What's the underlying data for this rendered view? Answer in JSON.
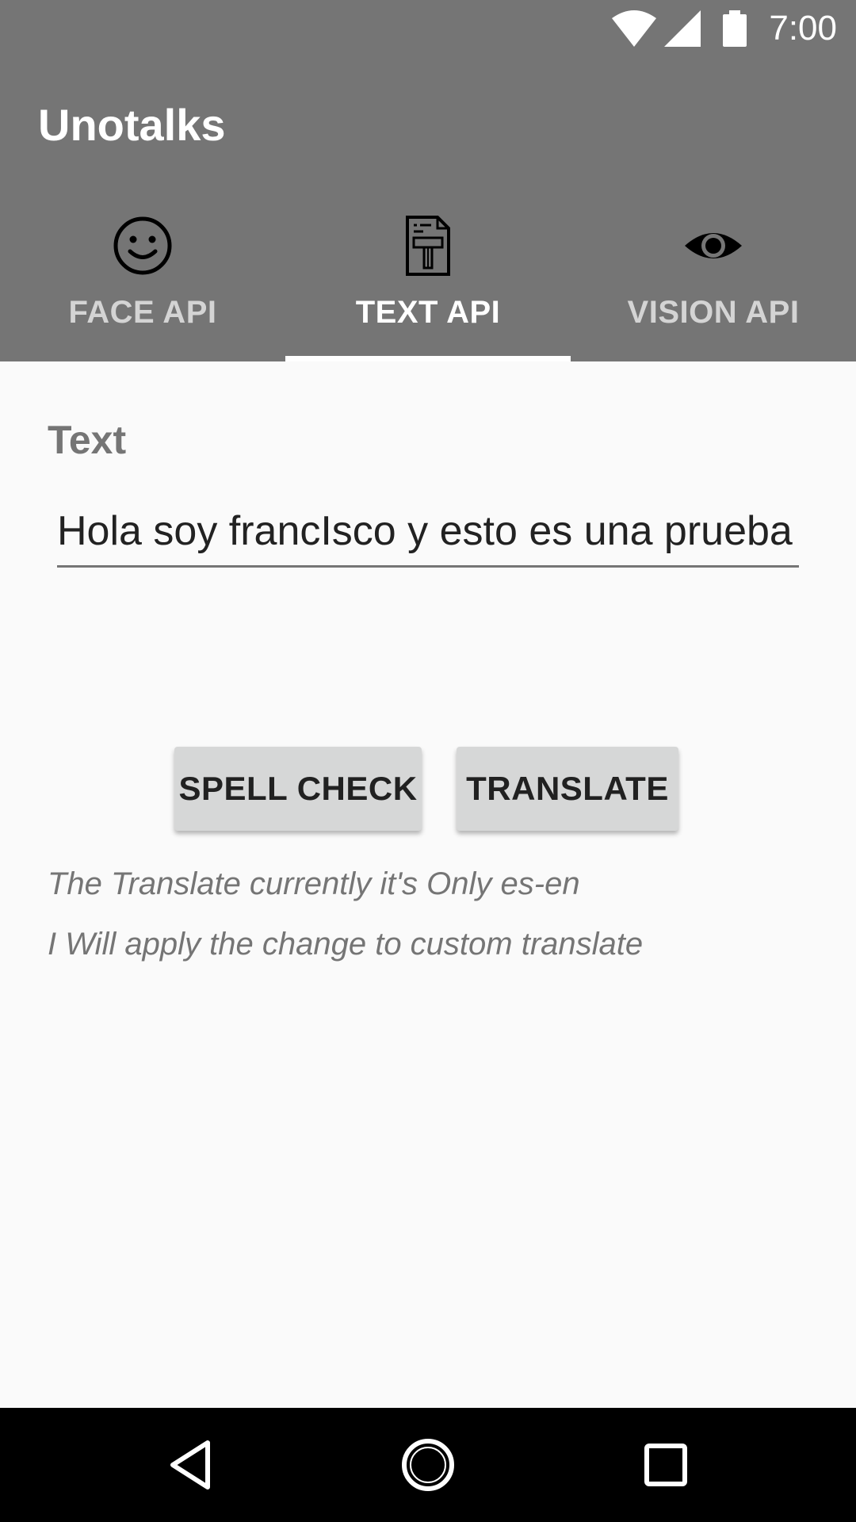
{
  "status_bar": {
    "time": "7:00"
  },
  "app": {
    "title": "Unotalks"
  },
  "tabs": [
    {
      "label": "FACE API",
      "icon": "smiley-face-icon"
    },
    {
      "label": "TEXT API",
      "icon": "text-document-icon"
    },
    {
      "label": "VISION API",
      "icon": "eye-icon"
    }
  ],
  "active_tab": "TEXT API",
  "form": {
    "label": "Text",
    "input_value": "Hola soy francIsco y esto es una prueba"
  },
  "buttons": {
    "spell_check": "SPELL CHECK",
    "translate": "TRANSLATE"
  },
  "notes": [
    "The Translate currently it's Only es-en",
    "I Will apply the change to custom translate"
  ],
  "colors": {
    "appbar": "#757575",
    "background": "#fafafa",
    "button": "#d6d7d7",
    "navbar": "#000000"
  }
}
